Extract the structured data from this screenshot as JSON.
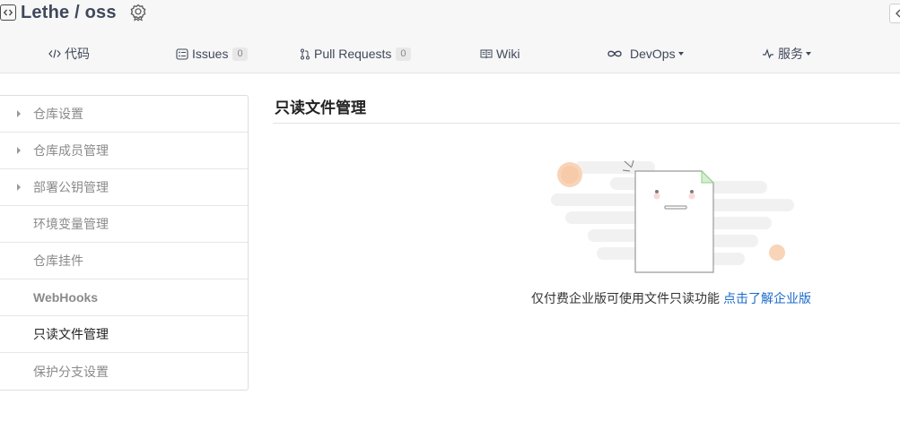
{
  "repo": {
    "title": "Lethe / oss",
    "icon": "code-icon",
    "badge_icon": "award-badge-icon"
  },
  "tabs": [
    {
      "label": "代码",
      "icon": "code-bracket-icon"
    },
    {
      "label": "Issues",
      "count": "0",
      "icon": "issues-icon"
    },
    {
      "label": "Pull Requests",
      "count": "0",
      "icon": "pull-request-icon"
    },
    {
      "label": "Wiki",
      "icon": "book-icon"
    },
    {
      "label": "DevOps",
      "icon": "infinity-icon",
      "dropdown": true
    },
    {
      "label": "服务",
      "icon": "pulse-icon",
      "dropdown": true
    }
  ],
  "sidebar": {
    "items": [
      {
        "label": "仓库设置",
        "expandable": true
      },
      {
        "label": "仓库成员管理",
        "expandable": true
      },
      {
        "label": "部署公钥管理",
        "expandable": true
      },
      {
        "label": "环境变量管理",
        "expandable": false
      },
      {
        "label": "仓库挂件",
        "expandable": false
      },
      {
        "label": "WebHooks",
        "expandable": false
      },
      {
        "label": "只读文件管理",
        "expandable": false,
        "active": true
      },
      {
        "label": "保护分支设置",
        "expandable": false
      }
    ]
  },
  "main": {
    "title": "只读文件管理",
    "empty_message": "仅付费企业版可使用文件只读功能",
    "empty_link": "点击了解企业版"
  },
  "colors": {
    "accent_link": "#1b6ac9",
    "title_text": "#40485b",
    "illustration_accent": "#f5c9a8",
    "illustration_note": "#8fd18a"
  }
}
